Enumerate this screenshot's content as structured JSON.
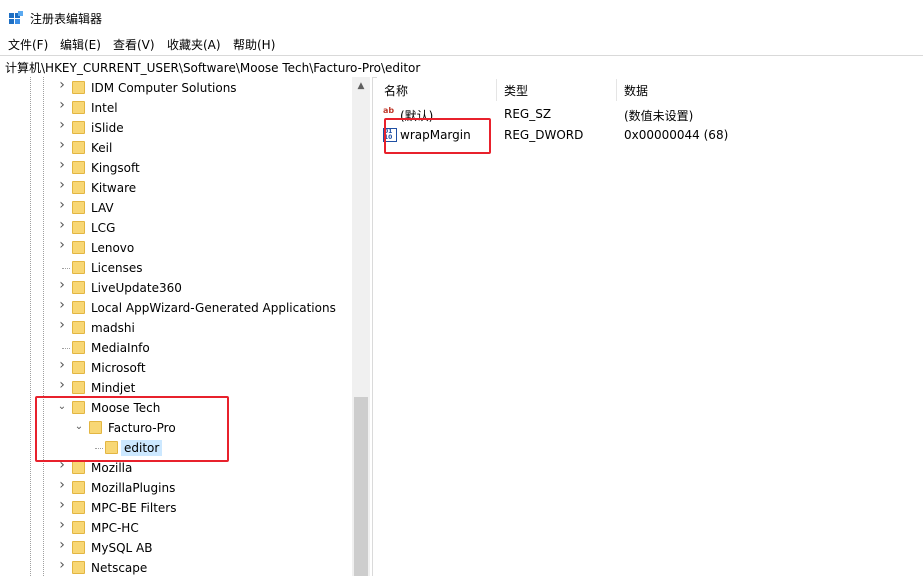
{
  "window": {
    "title": "注册表编辑器",
    "icon": "regedit-icon"
  },
  "menu": [
    "文件(F)",
    "编辑(E)",
    "查看(V)",
    "收藏夹(A)",
    "帮助(H)"
  ],
  "address": "计算机\\HKEY_CURRENT_USER\\Software\\Moose Tech\\Facturo-Pro\\editor",
  "tree": [
    {
      "label": "IDM Computer Solutions",
      "level": 0,
      "expander": "collapsed"
    },
    {
      "label": "Intel",
      "level": 0,
      "expander": "collapsed"
    },
    {
      "label": "iSlide",
      "level": 0,
      "expander": "collapsed"
    },
    {
      "label": "Keil",
      "level": 0,
      "expander": "collapsed"
    },
    {
      "label": "Kingsoft",
      "level": 0,
      "expander": "collapsed"
    },
    {
      "label": "Kitware",
      "level": 0,
      "expander": "collapsed"
    },
    {
      "label": "LAV",
      "level": 0,
      "expander": "collapsed"
    },
    {
      "label": "LCG",
      "level": 0,
      "expander": "collapsed"
    },
    {
      "label": "Lenovo",
      "level": 0,
      "expander": "collapsed"
    },
    {
      "label": "Licenses",
      "level": 0,
      "expander": "none"
    },
    {
      "label": "LiveUpdate360",
      "level": 0,
      "expander": "collapsed"
    },
    {
      "label": "Local AppWizard-Generated Applications",
      "level": 0,
      "expander": "collapsed"
    },
    {
      "label": "madshi",
      "level": 0,
      "expander": "collapsed"
    },
    {
      "label": "MediaInfo",
      "level": 0,
      "expander": "none"
    },
    {
      "label": "Microsoft",
      "level": 0,
      "expander": "collapsed"
    },
    {
      "label": "Mindjet",
      "level": 0,
      "expander": "collapsed"
    },
    {
      "label": "Moose Tech",
      "level": 0,
      "expander": "expanded"
    },
    {
      "label": "Facturo-Pro",
      "level": 1,
      "expander": "expanded"
    },
    {
      "label": "editor",
      "level": 2,
      "expander": "none",
      "selected": true
    },
    {
      "label": "Mozilla",
      "level": 0,
      "expander": "collapsed"
    },
    {
      "label": "MozillaPlugins",
      "level": 0,
      "expander": "collapsed"
    },
    {
      "label": "MPC-BE Filters",
      "level": 0,
      "expander": "collapsed"
    },
    {
      "label": "MPC-HC",
      "level": 0,
      "expander": "collapsed"
    },
    {
      "label": "MySQL AB",
      "level": 0,
      "expander": "collapsed"
    },
    {
      "label": "Netscape",
      "level": 0,
      "expander": "collapsed"
    }
  ],
  "columns": {
    "name": "名称",
    "type": "类型",
    "data": "数据"
  },
  "values": [
    {
      "name": "(默认)",
      "type": "REG_SZ",
      "data": "(数值未设置)",
      "icon": "string-value-icon"
    },
    {
      "name": "wrapMargin",
      "type": "REG_DWORD",
      "data": "0x00000044 (68)",
      "icon": "dword-value-icon"
    }
  ],
  "colors": {
    "highlight": "#e8212c",
    "selection": "#cce8ff",
    "folder": "#f8d775"
  }
}
